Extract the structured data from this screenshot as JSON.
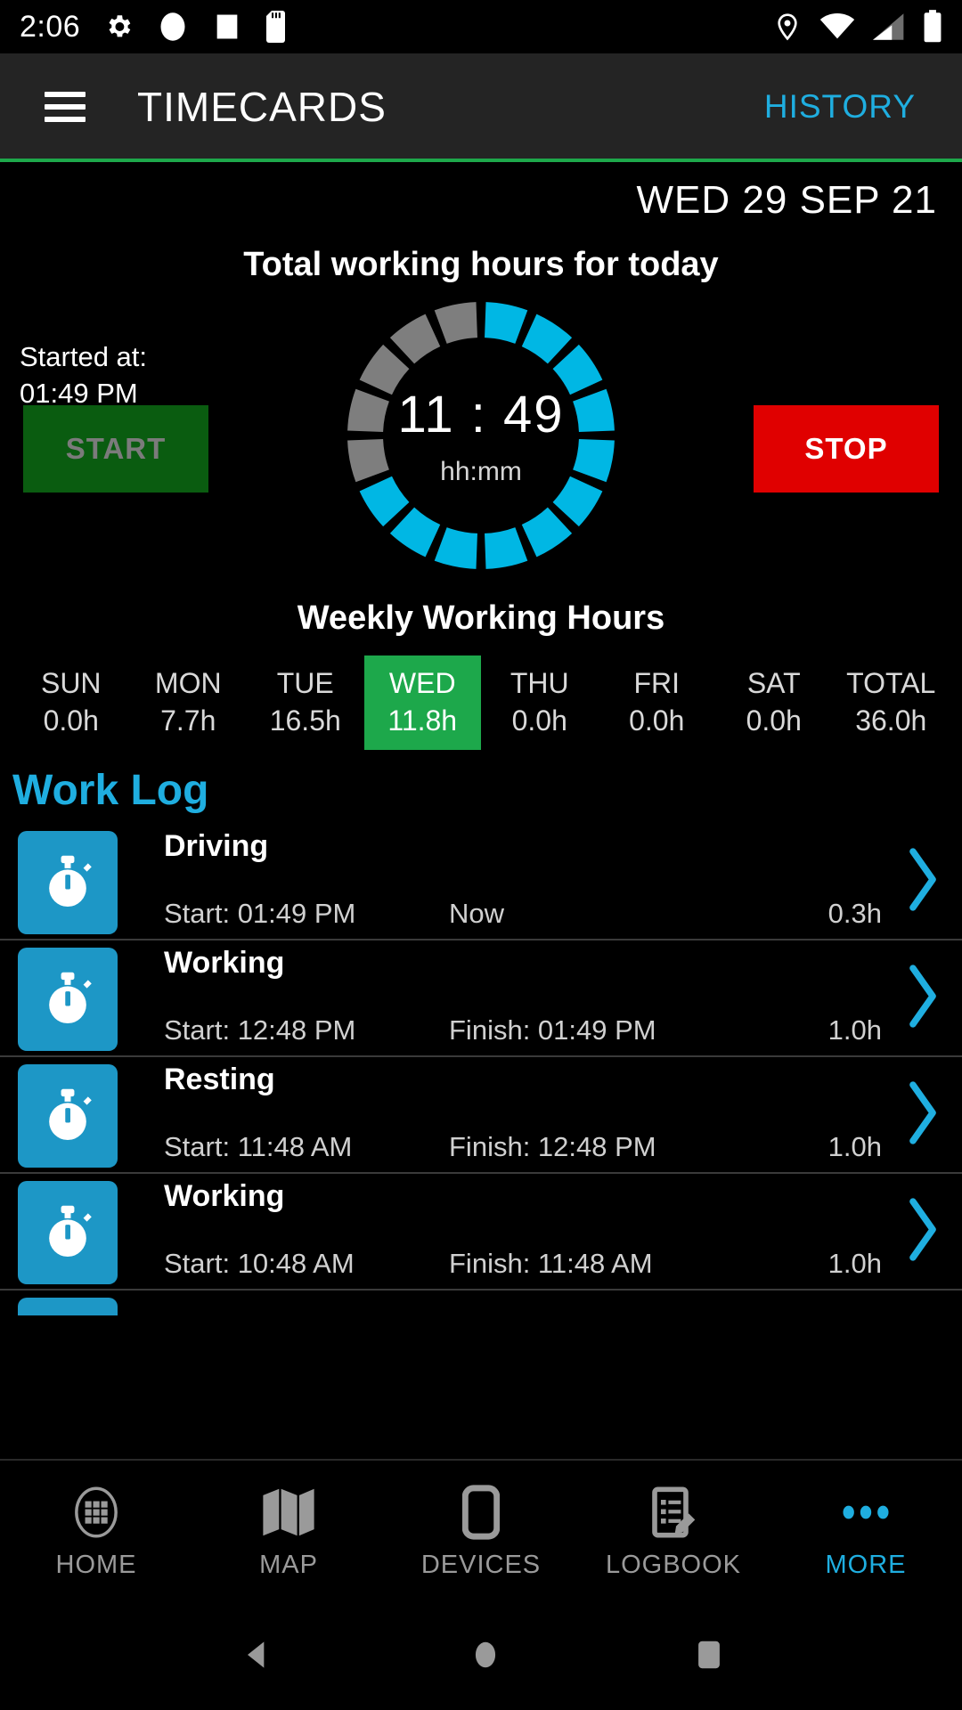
{
  "statusbar": {
    "clock": "2:06",
    "left_icons": [
      "gear-icon",
      "circle-icon",
      "square-icon",
      "sdcard-icon"
    ],
    "right_icons": [
      "location-icon",
      "wifi-icon",
      "signal-icon",
      "battery-icon"
    ]
  },
  "appbar": {
    "menu_icon": "hamburger-icon",
    "title": "TIMECARDS",
    "action": "HISTORY",
    "accent": "#1FAEE0",
    "underline_color": "#1DA84B",
    "background": "#242424"
  },
  "main": {
    "date": "WED 29 SEP 21",
    "total_hours_title": "Total working hours for today",
    "gauge": {
      "time": "11 : 49",
      "unit": "hh:mm",
      "segments_total": 16,
      "segments_filled": 11,
      "fill_color": "#00B7E4",
      "track_color": "#7E7E7E"
    },
    "started_label": "Started at:",
    "started_time": "01:49 PM",
    "start_button": "START",
    "stop_button": "STOP",
    "start_color": "#0A5C10",
    "stop_color": "#E00000"
  },
  "weekly": {
    "title": "Weekly Working Hours",
    "active_color": "#1DA84B",
    "days": [
      {
        "day": "SUN",
        "hours": "0.0h",
        "active": false
      },
      {
        "day": "MON",
        "hours": "7.7h",
        "active": false
      },
      {
        "day": "TUE",
        "hours": "16.5h",
        "active": false
      },
      {
        "day": "WED",
        "hours": "11.8h",
        "active": true
      },
      {
        "day": "THU",
        "hours": "0.0h",
        "active": false
      },
      {
        "day": "FRI",
        "hours": "0.0h",
        "active": false
      },
      {
        "day": "SAT",
        "hours": "0.0h",
        "active": false
      },
      {
        "day": "TOTAL",
        "hours": "36.0h",
        "active": false
      }
    ]
  },
  "worklog": {
    "heading": "Work Log",
    "tile_color": "#1D97C6",
    "entries": [
      {
        "icon": "stopwatch-icon",
        "title": "Driving",
        "start": "Start: 01:49 PM",
        "finish": "Now",
        "duration": "0.3h"
      },
      {
        "icon": "stopwatch-icon",
        "title": "Working",
        "start": "Start: 12:48 PM",
        "finish": "Finish: 01:49 PM",
        "duration": "1.0h"
      },
      {
        "icon": "stopwatch-icon",
        "title": "Resting",
        "start": "Start: 11:48 AM",
        "finish": "Finish: 12:48 PM",
        "duration": "1.0h"
      },
      {
        "icon": "stopwatch-icon",
        "title": "Working",
        "start": "Start: 10:48 AM",
        "finish": "Finish: 11:48 AM",
        "duration": "1.0h"
      }
    ]
  },
  "bottomnav": {
    "items": [
      {
        "label": "HOME",
        "icon": "grid-icon",
        "active": false
      },
      {
        "label": "MAP",
        "icon": "map-icon",
        "active": false
      },
      {
        "label": "DEVICES",
        "icon": "device-icon",
        "active": false
      },
      {
        "label": "LOGBOOK",
        "icon": "logbook-icon",
        "active": false
      },
      {
        "label": "MORE",
        "icon": "more-icon",
        "active": true
      }
    ],
    "active_color": "#1FAEE0",
    "inactive_color": "#9A9A9A"
  },
  "androidnav": {
    "buttons": [
      "back-icon",
      "home-icon",
      "recents-icon"
    ]
  }
}
